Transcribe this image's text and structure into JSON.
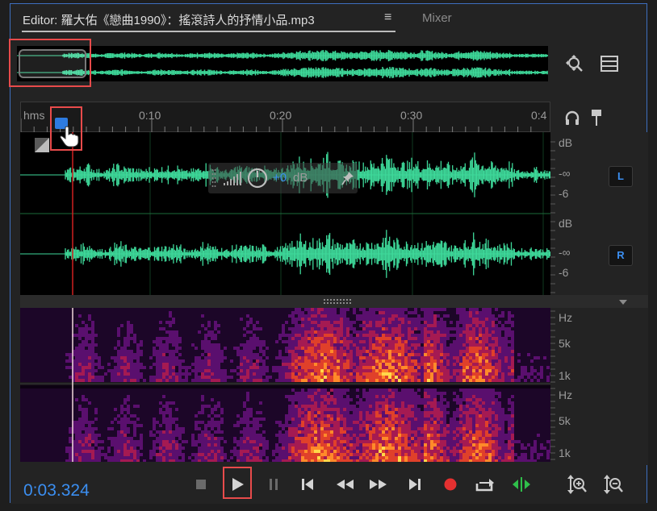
{
  "tabs": {
    "editor_label": "Editor: 羅大佑《戀曲1990》：搖滾詩人的抒情小品.mp3",
    "mixer_label": "Mixer",
    "menu_glyph": "≡"
  },
  "ruler": {
    "unit": "hms",
    "ticks": [
      "0:10",
      "0:20",
      "0:30",
      "0:4"
    ]
  },
  "hud": {
    "gain_value": "+0",
    "gain_unit": "dB"
  },
  "amplitude_scale": {
    "left": {
      "unit": "dB",
      "minus_inf": "-∞",
      "minus6": "-6",
      "channel": "L"
    },
    "right": {
      "unit": "dB",
      "minus_inf": "-∞",
      "minus6": "-6",
      "channel": "R"
    }
  },
  "frequency_scale": {
    "top": {
      "unit": "Hz",
      "mid": "5k",
      "low": "1k"
    },
    "bottom": {
      "unit": "Hz",
      "mid": "5k",
      "low": "1k"
    }
  },
  "transport": {
    "timecode": "0:03.324"
  },
  "colors": {
    "waveform": "#3ed99a",
    "accent": "#3b8ef0",
    "playhead": "#d02020",
    "highlight": "#e84b4b",
    "record": "#e53030",
    "loop_green": "#2fbf4a"
  },
  "icons": [
    "zoom-fit-icon",
    "list-icon",
    "headphone-icon",
    "marker-pin-icon",
    "hand-icon",
    "stop-icon",
    "play-icon",
    "pause-icon",
    "skip-start-icon",
    "rewind-icon",
    "fast-forward-icon",
    "skip-end-icon",
    "record-icon",
    "loop-icon",
    "skip-selection-icon",
    "zoom-in-amplitude-icon",
    "zoom-out-amplitude-icon"
  ]
}
